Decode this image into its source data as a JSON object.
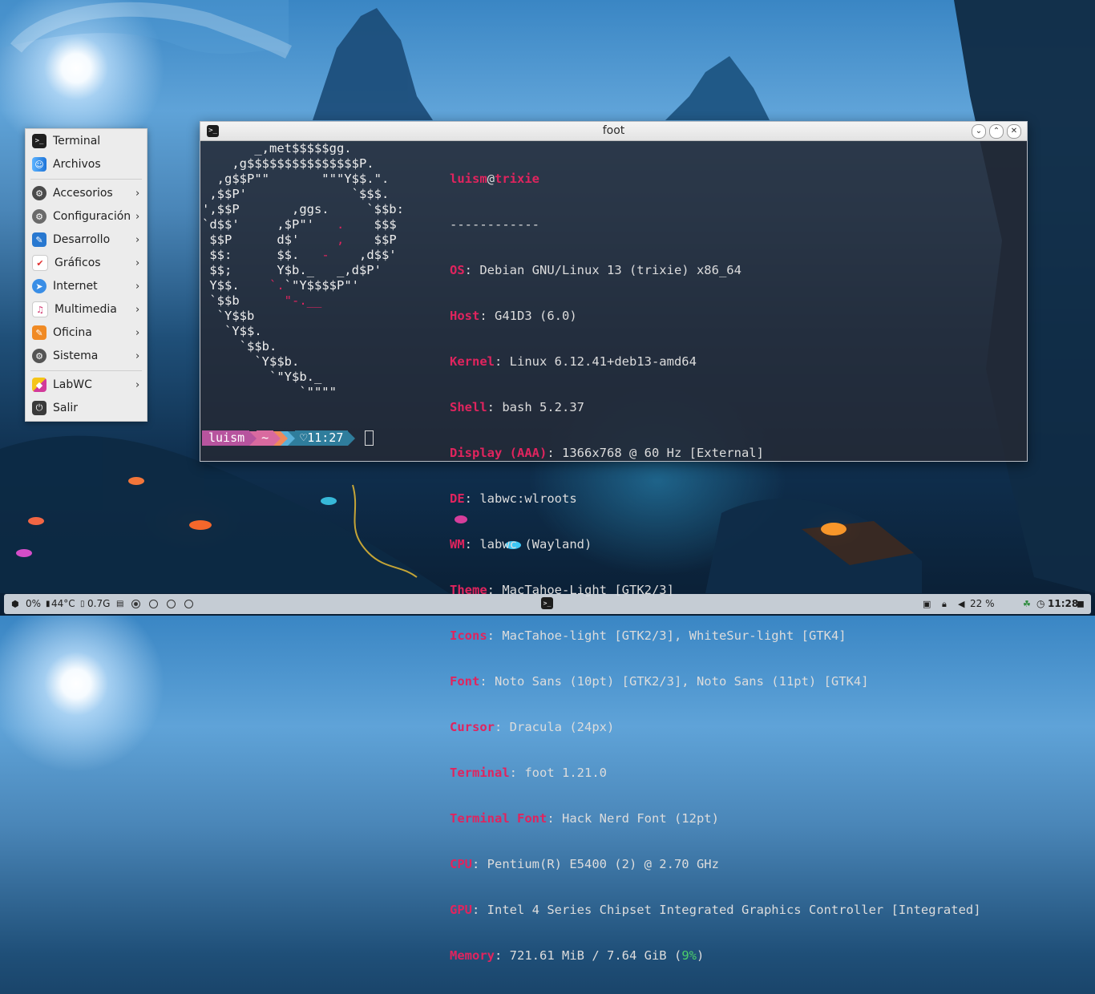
{
  "menu": {
    "items": [
      {
        "label": "Terminal",
        "icon": "terminal-icon",
        "submenu": false,
        "color": "#1f1f1f",
        "glyph": ">_"
      },
      {
        "label": "Archivos",
        "icon": "files-icon",
        "submenu": false,
        "color": "#2f8de4",
        "glyph": "☺"
      },
      {
        "label": "Accesorios",
        "icon": "accessories-icon",
        "submenu": true,
        "color": "#4a4a4a",
        "glyph": "⚙"
      },
      {
        "label": "Configuración",
        "icon": "settings-icon",
        "submenu": true,
        "color": "#6a6a6a",
        "glyph": "⚙"
      },
      {
        "label": "Desarrollo",
        "icon": "development-icon",
        "submenu": true,
        "color": "#2878d0",
        "glyph": "✎"
      },
      {
        "label": "Gráficos",
        "icon": "graphics-icon",
        "submenu": true,
        "color": "#ffffff",
        "glyph": "✔"
      },
      {
        "label": "Internet",
        "icon": "internet-icon",
        "submenu": true,
        "color": "#3a8ee6",
        "glyph": "➤"
      },
      {
        "label": "Multimedia",
        "icon": "multimedia-icon",
        "submenu": true,
        "color": "#ffffff",
        "glyph": "♫"
      },
      {
        "label": "Oficina",
        "icon": "office-icon",
        "submenu": true,
        "color": "#f08a24",
        "glyph": "✎"
      },
      {
        "label": "Sistema",
        "icon": "system-icon",
        "submenu": true,
        "color": "#555555",
        "glyph": "⚙"
      },
      {
        "label": "LabWC",
        "icon": "labwc-icon",
        "submenu": true,
        "color": "#ffffff",
        "glyph": "◆"
      },
      {
        "label": "Salir",
        "icon": "power-icon",
        "submenu": false,
        "color": "#3a3a3a",
        "glyph": "⏻"
      }
    ]
  },
  "window": {
    "title": "foot"
  },
  "fetch": {
    "user": "luism",
    "at": "@",
    "host": "trixie",
    "separator": "------------",
    "rows": [
      {
        "key": "OS",
        "value": "Debian GNU/Linux 13 (trixie) x86_64"
      },
      {
        "key": "Host",
        "value": "G41D3 (6.0)"
      },
      {
        "key": "Kernel",
        "value": "Linux 6.12.41+deb13-amd64"
      },
      {
        "key": "Shell",
        "value": "bash 5.2.37"
      },
      {
        "key": "Display (AAA)",
        "value": "1366x768 @ 60 Hz [External]"
      },
      {
        "key": "DE",
        "value": "labwc:wlroots"
      },
      {
        "key": "WM",
        "value": "labwc (Wayland)"
      },
      {
        "key": "Theme",
        "value": "MacTahoe-Light [GTK2/3]"
      },
      {
        "key": "Icons",
        "value": "MacTahoe-light [GTK2/3], WhiteSur-light [GTK4]"
      },
      {
        "key": "Font",
        "value": "Noto Sans (10pt) [GTK2/3], Noto Sans (11pt) [GTK4]"
      },
      {
        "key": "Cursor",
        "value": "Dracula (24px)"
      },
      {
        "key": "Terminal",
        "value": "foot 1.21.0"
      },
      {
        "key": "Terminal Font",
        "value": "Hack Nerd Font (12pt)"
      },
      {
        "key": "CPU",
        "value": "Pentium(R) E5400 (2) @ 2.70 GHz"
      },
      {
        "key": "GPU",
        "value": "Intel 4 Series Chipset Integrated Graphics Controller [Integrated]"
      }
    ],
    "memory_key": "Memory",
    "memory_value": "721.61 MiB / 7.64 GiB (",
    "memory_pct": "9%",
    "memory_close": ")"
  },
  "prompt": {
    "user": "luism",
    "dir": "~",
    "time": "♡11:27"
  },
  "panel": {
    "cpu": "0%",
    "temp": "44°C",
    "mem": "0.7G",
    "volume": "22 %",
    "clock": "11:28"
  }
}
